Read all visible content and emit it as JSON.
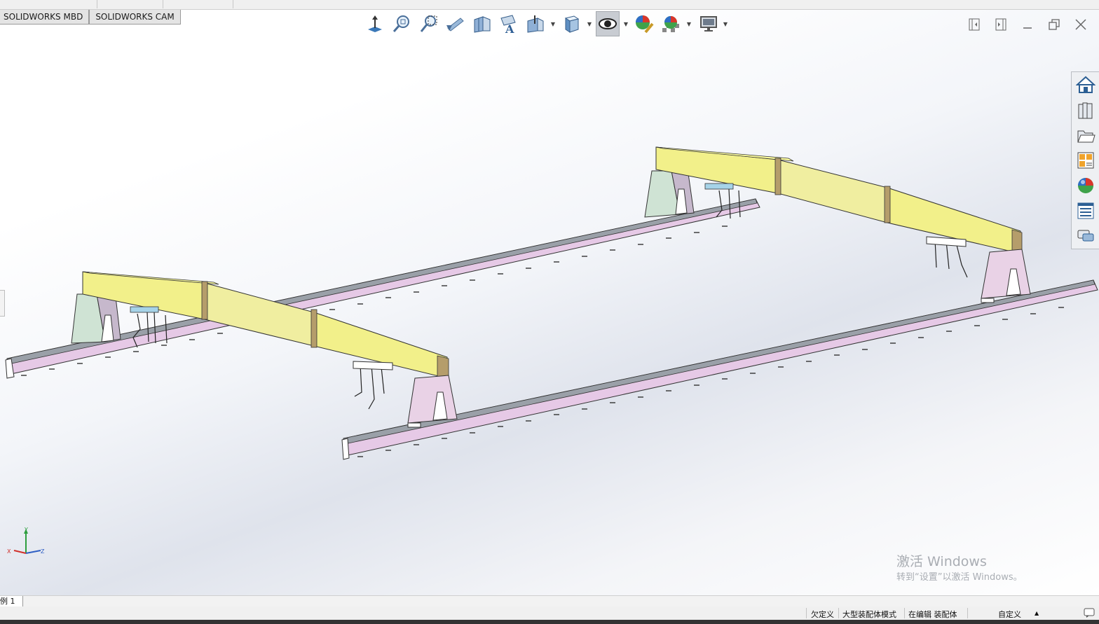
{
  "tabs": [
    "SOLIDWORKS MBD",
    "SOLIDWORKS CAM"
  ],
  "heads_up_toolbar": [
    {
      "name": "view-orientation-icon"
    },
    {
      "name": "zoom-to-fit-icon"
    },
    {
      "name": "zoom-to-area-icon"
    },
    {
      "name": "previous-view-icon"
    },
    {
      "name": "section-view-icon"
    },
    {
      "name": "dynamic-annotation-views-icon"
    },
    {
      "name": "view-orientation-dropdown-icon"
    },
    {
      "name": "display-style-icon"
    },
    {
      "name": "hide-show-items-icon"
    },
    {
      "name": "edit-appearance-icon"
    },
    {
      "name": "apply-scene-icon"
    },
    {
      "name": "view-settings-icon"
    }
  ],
  "task_pane": [
    {
      "name": "solidworks-resources-icon"
    },
    {
      "name": "design-library-icon"
    },
    {
      "name": "file-explorer-icon"
    },
    {
      "name": "view-palette-icon"
    },
    {
      "name": "appearances-scenes-icon"
    },
    {
      "name": "custom-properties-icon"
    },
    {
      "name": "solidworks-forum-icon"
    }
  ],
  "triad": {
    "y": "Y",
    "x": "X",
    "z": "Z"
  },
  "watermark": {
    "line1": "激活 Windows",
    "line2": "转到“设置”以激活 Windows。"
  },
  "sheet_tab": "例 1",
  "status": {
    "state": "欠定义",
    "mode": "大型装配体模式",
    "editing": "在编辑 装配体",
    "units": "自定义"
  },
  "colors": {
    "beam": "#f2f08a",
    "rail": "#e6c9e6",
    "leg_green": "#cfe3d4",
    "leg_purple": "#c6b8cc",
    "leg_pink": "#e9d2e6"
  }
}
